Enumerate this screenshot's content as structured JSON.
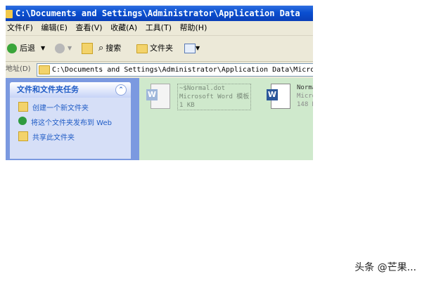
{
  "window": {
    "title": "C:\\Documents and Settings\\Administrator\\Application Data"
  },
  "menubar": {
    "items": [
      "文件(F)",
      "编辑(E)",
      "查看(V)",
      "收藏(A)",
      "工具(T)",
      "帮助(H)"
    ]
  },
  "toolbar": {
    "back_label": "后退",
    "search_label": "搜索",
    "folders_label": "文件夹"
  },
  "address": {
    "label": "地址(D)",
    "value": "C:\\Documents and Settings\\Administrator\\Application Data\\Microsoft"
  },
  "tasks": {
    "heading": "文件和文件夹任务",
    "items": [
      "创建一个新文件夹",
      "将这个文件夹发布到 Web",
      "共享此文件夹"
    ]
  },
  "files": [
    {
      "name": "~$Normal.dot",
      "type": "Microsoft Word 模板",
      "size": "1 KB"
    },
    {
      "name": "Norma",
      "type": "Micro",
      "size": "148 K"
    }
  ],
  "footer": {
    "watermark": "头条 @芒果..."
  },
  "colors": {
    "titlebar": "#0a4fd0",
    "content_bg": "#cfe9cc",
    "task_link": "#215dc6"
  }
}
